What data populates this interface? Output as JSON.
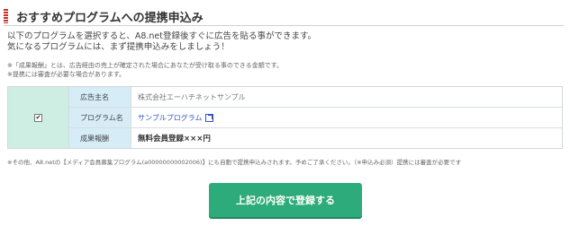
{
  "header": {
    "title": "おすすめプログラムへの提携申込み"
  },
  "intro": {
    "line1": "以下のプログラムを選択すると、A8.net登録後すぐに広告を貼る事ができます。",
    "line2": "気になるプログラムには、まず提携申込みをしましょう！"
  },
  "notes": {
    "line1": "※「成果報酬」とは、広告経由の売上が確定された場合にあなたが受け取る事のできる金額です。",
    "line2": "※提携には審査が必要な場合があります。"
  },
  "program": {
    "checked": true,
    "check_mark": "✔",
    "rows": [
      {
        "label": "広告主名",
        "value": "株式会社エーハチネットサンプル"
      },
      {
        "label": "プログラム名",
        "value": "サンプルプログラム"
      },
      {
        "label": "成果報酬",
        "value": "無料会員登録×××円"
      }
    ]
  },
  "footnote": "※その他、A8.netの【メディア会員募集プログラム(a00000000002006)】にも自動で提携申込みされます。予めご了承ください。（※申込み必須）提携には審査が必要です",
  "submit_button": {
    "label": "上記の内容で登録する"
  },
  "colors": {
    "accent": "#2eab7a",
    "header_marker": "#c8322b",
    "check_cell": "#cfeee3",
    "label_cell": "#d6ecf7",
    "link": "#3355bb"
  },
  "icons": {
    "header_marker": "header-marker-icon",
    "external_link": "external-link-icon"
  }
}
